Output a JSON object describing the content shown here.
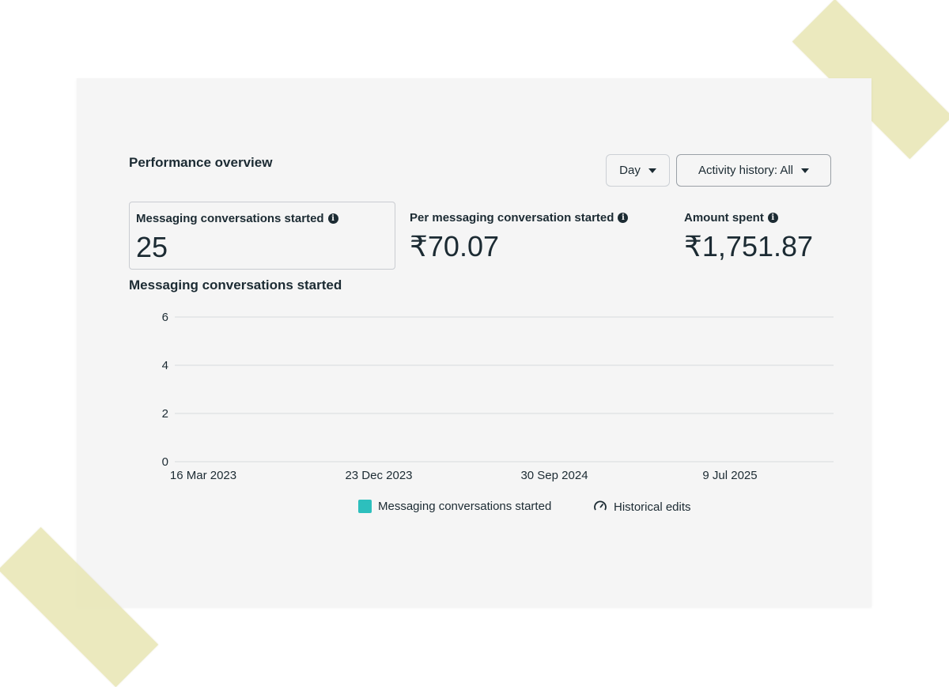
{
  "header": {
    "title": "Performance overview",
    "day_dropdown": "Day",
    "activity_dropdown": "Activity history: All"
  },
  "metrics": [
    {
      "label": "Messaging conversations started",
      "value": "25"
    },
    {
      "label": "Per messaging conversation started",
      "value": "₹70.07"
    },
    {
      "label": "Amount spent",
      "value": "₹1,751.87"
    }
  ],
  "chart_title": "Messaging conversations started",
  "legend": {
    "series_label": "Messaging conversations started",
    "historical_label": "Historical edits"
  },
  "colors": {
    "series": "#2dbfbd",
    "gridline": "#d8dadd",
    "text": "#1c2b33"
  },
  "chart_data": {
    "type": "line",
    "title": "Messaging conversations started",
    "xlabel": "",
    "ylabel": "",
    "x_ticks": [
      "16 Mar 2023",
      "23 Dec 2023",
      "30 Sep 2024",
      "9 Jul 2025"
    ],
    "y_ticks": [
      0,
      2,
      4,
      6
    ],
    "ylim": [
      0,
      6
    ],
    "grid": true,
    "legend_position": "bottom-center",
    "series": [
      {
        "name": "Messaging conversations started",
        "x": [],
        "values": []
      }
    ]
  }
}
